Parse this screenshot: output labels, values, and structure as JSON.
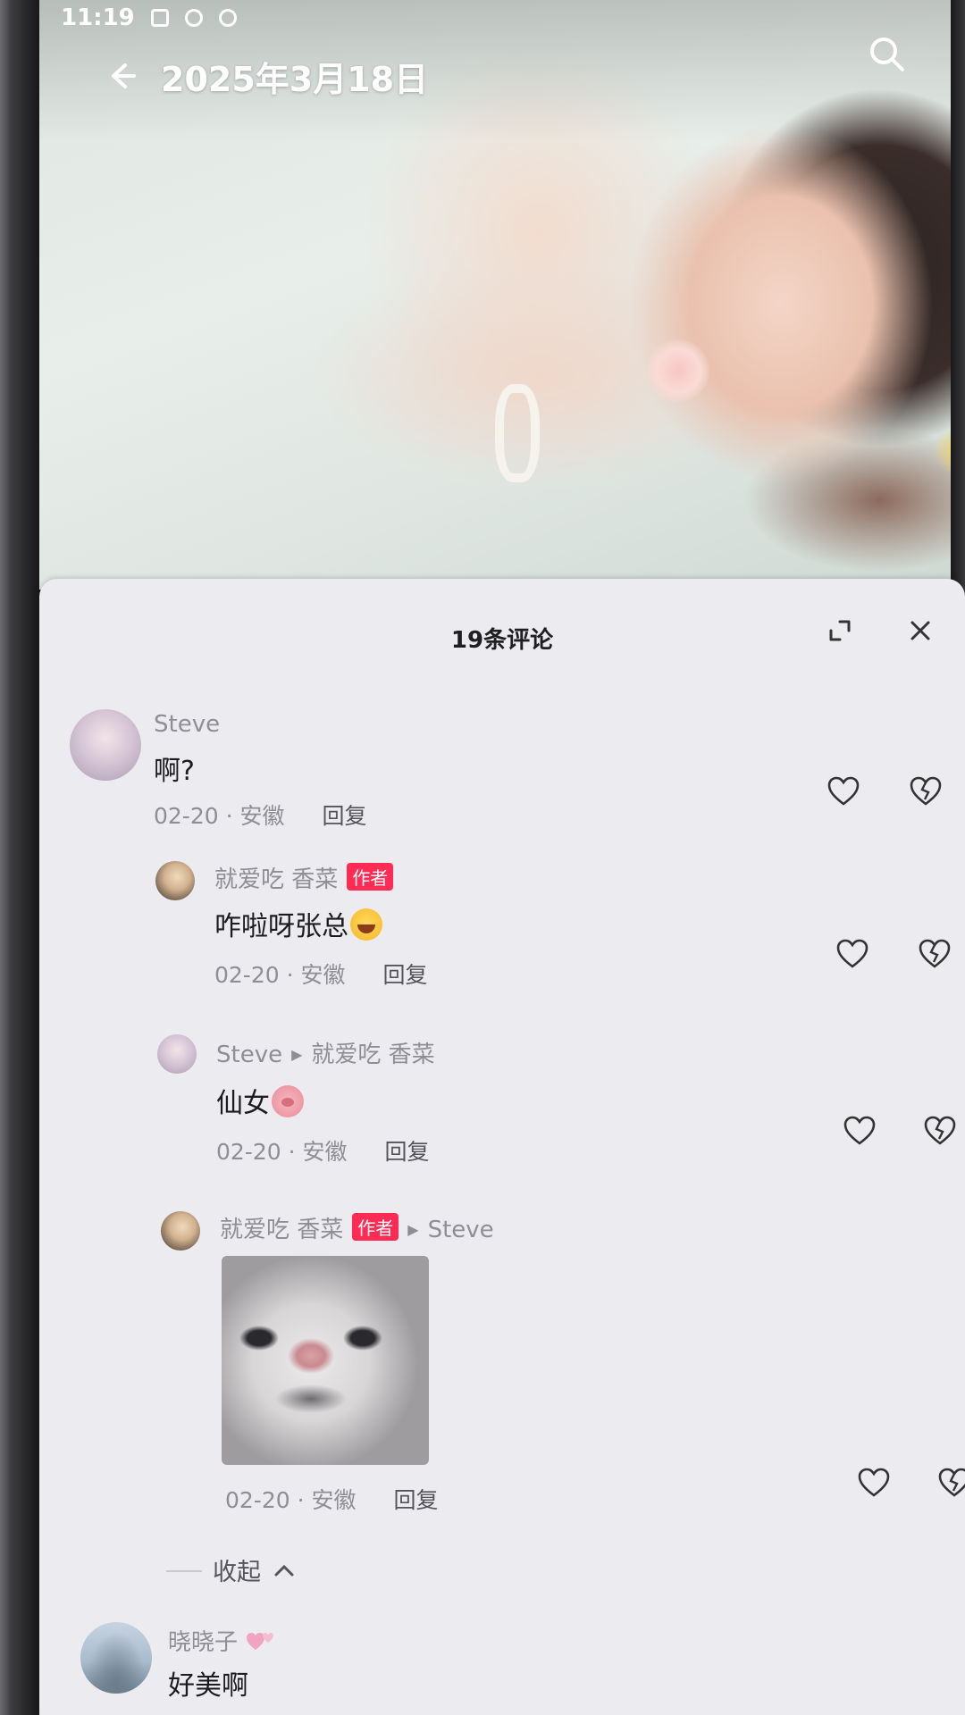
{
  "status_bar": {
    "time": "11:19"
  },
  "header": {
    "title": "2025年3月18日"
  },
  "comments_panel": {
    "title": "19条评论",
    "collapse_label": "收起",
    "comments": [
      {
        "user": "Steve",
        "text": "啊?",
        "date": "02-20",
        "location": "安徽",
        "reply_label": "回复"
      },
      {
        "user": "就爱吃 香菜",
        "badge": "作者",
        "text": "咋啦呀张总",
        "emoji": "rolling-laugh-emoji",
        "date": "02-20",
        "location": "安徽",
        "reply_label": "回复"
      },
      {
        "user": "Steve",
        "reply_to": "就爱吃 香菜",
        "text": "仙女",
        "emoji": "pig-face-emoji",
        "date": "02-20",
        "location": "安徽",
        "reply_label": "回复"
      },
      {
        "user": "就爱吃 香菜",
        "badge": "作者",
        "reply_to": "Steve",
        "sticker": "cat-face-sticker",
        "date": "02-20",
        "location": "安徽",
        "reply_label": "回复"
      },
      {
        "user": "晓晓子",
        "user_suffix_emoji": "pink-hearts-emoji",
        "text": "好美啊"
      }
    ]
  },
  "colors": {
    "sheet_background": "#ecebef",
    "author_badge": "#fe2c55",
    "secondary_text": "#8f8e95"
  },
  "icons": [
    "back-arrow-icon",
    "search-icon",
    "expand-icon",
    "close-icon",
    "heart-icon",
    "broken-heart-icon",
    "chevron-up-icon"
  ]
}
